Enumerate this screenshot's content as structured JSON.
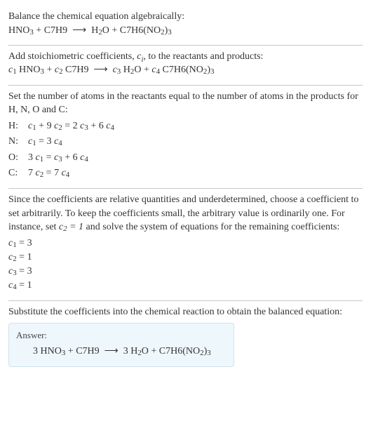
{
  "s1": {
    "intro": "Balance the chemical equation algebraically:",
    "eq": "HNO₃ + C7H9 ⟶ H₂O + C7H6(NO₂)₃"
  },
  "s2": {
    "intro_a": "Add stoichiometric coefficients, ",
    "intro_ci": "cᵢ",
    "intro_b": ", to the reactants and products:",
    "eq": "c₁ HNO₃ + c₂ C7H9 ⟶ c₃ H₂O + c₄ C7H6(NO₂)₃"
  },
  "s3": {
    "intro": "Set the number of atoms in the reactants equal to the number of atoms in the products for H, N, O and C:",
    "rows": {
      "H": {
        "label": "H:",
        "eq": "c₁ + 9 c₂ = 2 c₃ + 6 c₄"
      },
      "N": {
        "label": "N:",
        "eq": "c₁ = 3 c₄"
      },
      "O": {
        "label": "O:",
        "eq": "3 c₁ = c₃ + 6 c₄"
      },
      "C": {
        "label": "C:",
        "eq": "7 c₂ = 7 c₄"
      }
    }
  },
  "s4": {
    "intro_a": "Since the coefficients are relative quantities and underdetermined, choose a coefficient to set arbitrarily. To keep the coefficients small, the arbitrary value is ordinarily one. For instance, set ",
    "intro_set": "c₂ = 1",
    "intro_b": " and solve the system of equations for the remaining coefficients:",
    "coeffs": {
      "c1": "c₁ = 3",
      "c2": "c₂ = 1",
      "c3": "c₃ = 3",
      "c4": "c₄ = 1"
    }
  },
  "s5": {
    "intro": "Substitute the coefficients into the chemical reaction to obtain the balanced equation:",
    "answer_label": "Answer:",
    "answer_eq": "3 HNO₃ + C7H9 ⟶ 3 H₂O + C7H6(NO₂)₃"
  }
}
